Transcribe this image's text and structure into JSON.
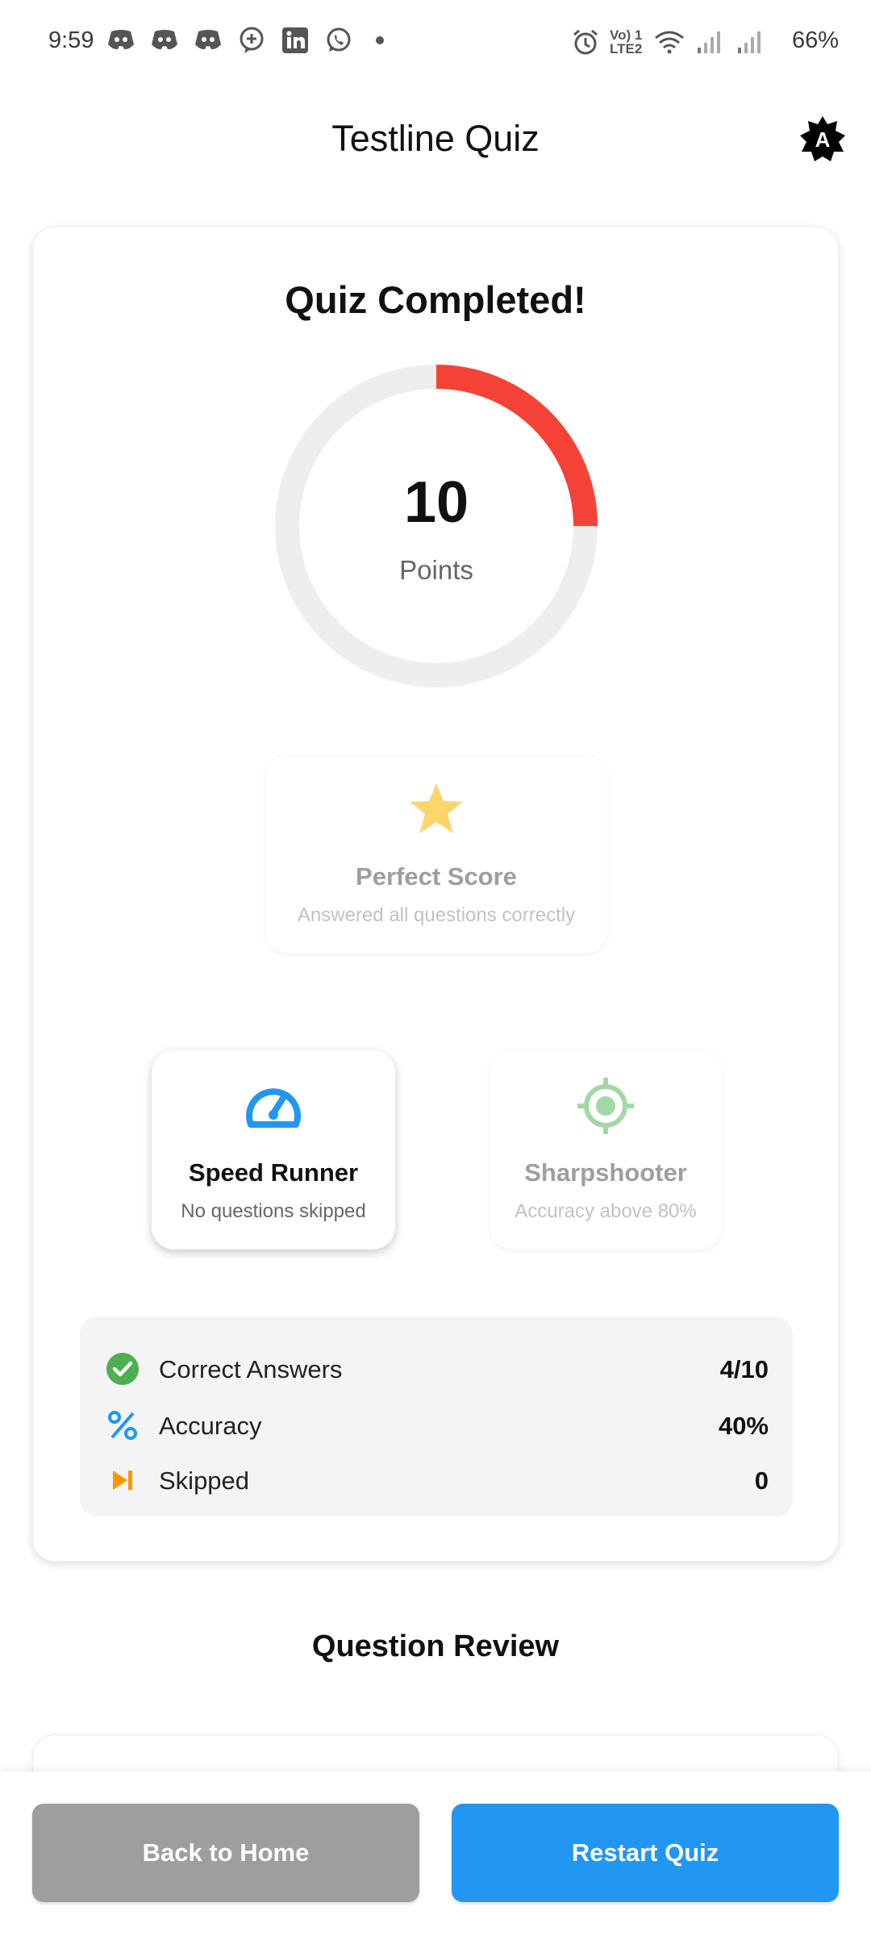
{
  "status_bar": {
    "time": "9:59",
    "battery": "66%",
    "network_label": "Vo) 1 LTE2",
    "left_icons": [
      "discord-icon",
      "discord-icon",
      "discord-icon",
      "chat-plus-icon",
      "linkedin-icon",
      "whatsapp-icon"
    ],
    "right_icons": [
      "alarm-icon",
      "volte-icon",
      "wifi-icon",
      "signal-icon",
      "signal-icon"
    ]
  },
  "app_bar": {
    "title": "Testline Quiz",
    "theme_icon": "auto-brightness-icon"
  },
  "result": {
    "heading": "Quiz Completed!",
    "score": "10",
    "score_label": "Points",
    "score_progress_fraction": 0.25,
    "ring_color": "#f44336",
    "track_color": "#eeeeee"
  },
  "badges": [
    {
      "title": "Perfect Score",
      "description": "Answered all questions correctly",
      "icon": "star-icon",
      "earned": false,
      "color": "#fdd56c"
    },
    {
      "title": "Speed Runner",
      "description": "No questions skipped",
      "icon": "speedometer-icon",
      "earned": true,
      "color": "#2196f3"
    },
    {
      "title": "Sharpshooter",
      "description": "Accuracy above 80%",
      "icon": "crosshair-icon",
      "earned": false,
      "color": "#a5d6a7"
    }
  ],
  "stats": [
    {
      "label": "Correct Answers",
      "value": "4/10",
      "icon": "check-circle-icon",
      "color": "#4caf50"
    },
    {
      "label": "Accuracy",
      "value": "40%",
      "icon": "percent-icon",
      "color": "#2196f3"
    },
    {
      "label": "Skipped",
      "value": "0",
      "icon": "skip-next-icon",
      "color": "#ff9800"
    }
  ],
  "review": {
    "title": "Question Review"
  },
  "actions": {
    "back_home": "Back to Home",
    "restart": "Restart Quiz"
  },
  "colors": {
    "primary": "#2196f3",
    "secondary_button": "#9e9e9e",
    "score_ring": "#f44336"
  }
}
